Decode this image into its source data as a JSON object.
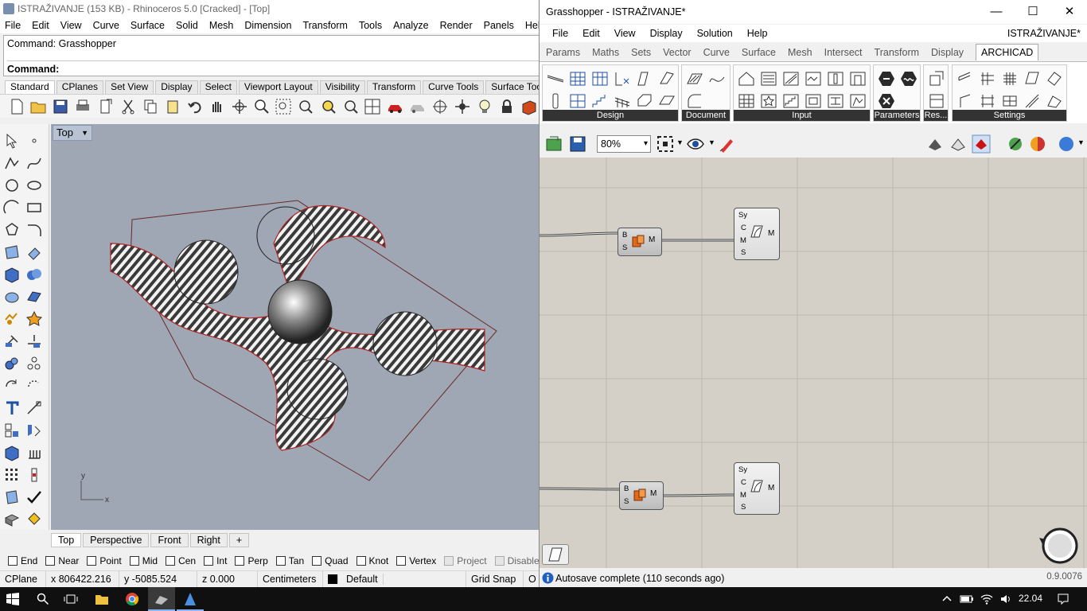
{
  "rhino": {
    "title": "ISTRAŽIVANJE (153 KB) - Rhinoceros 5.0 [Cracked] - [Top]",
    "menu": [
      "File",
      "Edit",
      "View",
      "Curve",
      "Surface",
      "Solid",
      "Mesh",
      "Dimension",
      "Transform",
      "Tools",
      "Analyze",
      "Render",
      "Panels",
      "Help"
    ],
    "command_history": "Command: Grasshopper",
    "command_prompt": "Command:",
    "toolbar_tabs": [
      "Standard",
      "CPlanes",
      "Set View",
      "Display",
      "Select",
      "Viewport Layout",
      "Visibility",
      "Transform",
      "Curve Tools",
      "Surface Tools"
    ],
    "viewport_label": "Top",
    "viewport_tabs": [
      "Top",
      "Perspective",
      "Front",
      "Right",
      "+"
    ],
    "axis_y": "y",
    "axis_x": "x",
    "osnaps": [
      {
        "label": "End",
        "enabled": true
      },
      {
        "label": "Near",
        "enabled": true
      },
      {
        "label": "Point",
        "enabled": true
      },
      {
        "label": "Mid",
        "enabled": true
      },
      {
        "label": "Cen",
        "enabled": true
      },
      {
        "label": "Int",
        "enabled": true
      },
      {
        "label": "Perp",
        "enabled": true
      },
      {
        "label": "Tan",
        "enabled": true
      },
      {
        "label": "Quad",
        "enabled": true
      },
      {
        "label": "Knot",
        "enabled": true
      },
      {
        "label": "Vertex",
        "enabled": true
      },
      {
        "label": "Project",
        "enabled": false
      },
      {
        "label": "Disable",
        "enabled": false
      }
    ],
    "status": {
      "cplane": "CPlane",
      "x": "x 806422.216",
      "y": "y -5085.524",
      "z": "z 0.000",
      "units": "Centimeters",
      "layer": "Default",
      "grid_snap": "Grid Snap",
      "ortho": "O"
    }
  },
  "grasshopper": {
    "title": "Grasshopper - ISTRAŽIVANJE*",
    "menu": [
      "File",
      "Edit",
      "View",
      "Display",
      "Solution",
      "Help"
    ],
    "document_name": "ISTRAŽIVANJE*",
    "tabs": [
      "Params",
      "Maths",
      "Sets",
      "Vector",
      "Curve",
      "Surface",
      "Mesh",
      "Intersect",
      "Transform",
      "Display",
      "ARCHICAD"
    ],
    "active_tab": "ARCHICAD",
    "ribbon_groups": [
      "Design",
      "Document",
      "Input",
      "Parameters",
      "Res...",
      "Settings"
    ],
    "zoom": "80%",
    "components": [
      {
        "inputs": [
          "B",
          "S"
        ],
        "outputs": [
          "M"
        ]
      },
      {
        "inputs": [
          "Sy",
          "C",
          "M",
          "S"
        ],
        "outputs": [
          "M"
        ]
      },
      {
        "inputs": [
          "B",
          "S"
        ],
        "outputs": [
          "M"
        ]
      },
      {
        "inputs": [
          "Sy",
          "C",
          "M",
          "S"
        ],
        "outputs": [
          "M"
        ]
      }
    ],
    "status": "Autosave complete (110 seconds ago)",
    "version": "0.9.0076",
    "window_controls": {
      "minimize": "—",
      "maximize": "☐",
      "close": "✕"
    }
  },
  "taskbar": {
    "time": "22.04"
  },
  "colors": {
    "viewport_bg": "#9ea7b3",
    "gh_canvas": "#d4d0c8",
    "ribbon_label": "#333333",
    "taskbar": "#101010"
  }
}
